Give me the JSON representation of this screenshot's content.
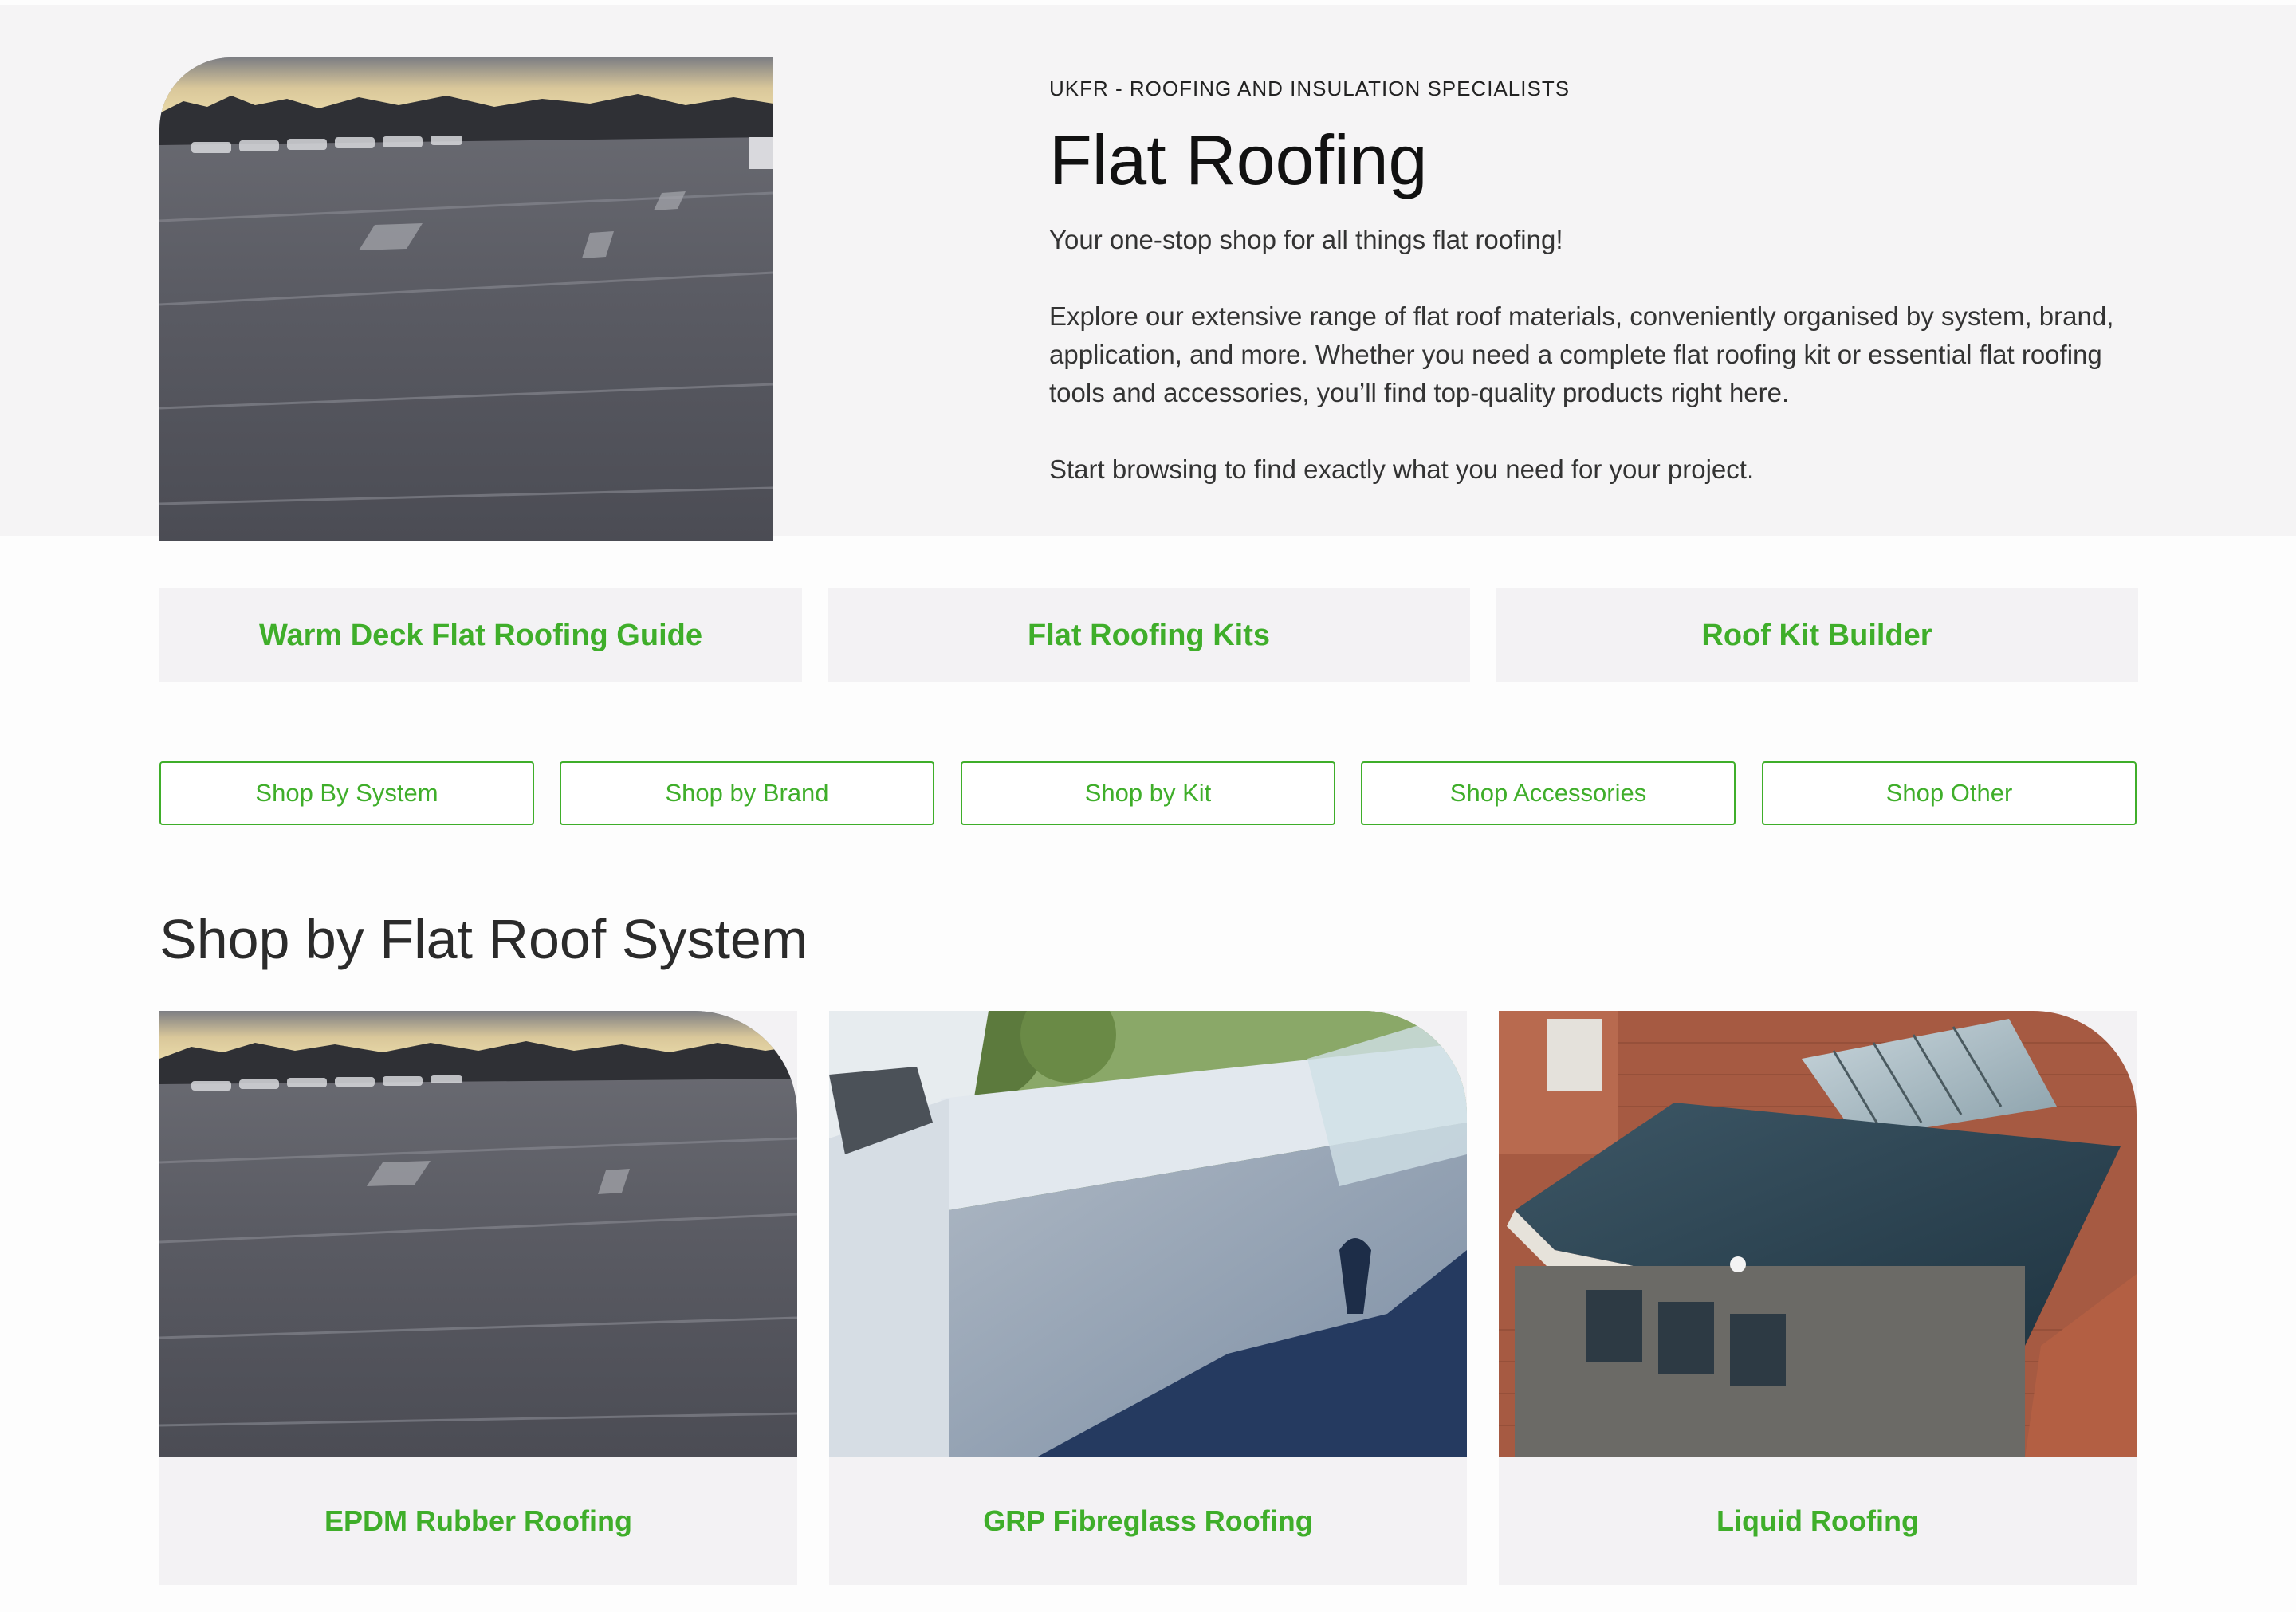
{
  "hero": {
    "eyebrow": "UKFR - ROOFING AND INSULATION SPECIALISTS",
    "title": "Flat Roofing",
    "paragraphs": [
      "Your one-stop shop for all things flat roofing!",
      "Explore our extensive range of flat roof materials, conveniently organised by system, brand, application, and more. Whether you need a complete flat roofing kit or essential flat roofing tools and accessories, you’ll find top-quality products right here.",
      "Start browsing to find exactly what you need for your project."
    ],
    "image": "epdm-roof-photo"
  },
  "link_cards": [
    {
      "label": "Warm Deck Flat Roofing Guide"
    },
    {
      "label": "Flat Roofing Kits"
    },
    {
      "label": "Roof Kit Builder"
    }
  ],
  "shop_buttons": [
    {
      "label": "Shop By System"
    },
    {
      "label": "Shop by Brand"
    },
    {
      "label": "Shop by Kit"
    },
    {
      "label": "Shop Accessories"
    },
    {
      "label": "Shop Other"
    }
  ],
  "systems_section": {
    "title": "Shop by Flat Roof System",
    "cards": [
      {
        "label": "EPDM Rubber Roofing",
        "image": "epdm-roof-photo"
      },
      {
        "label": "GRP Fibreglass Roofing",
        "image": "grp-roof-photo"
      },
      {
        "label": "Liquid Roofing",
        "image": "liquid-roof-photo"
      }
    ]
  },
  "colors": {
    "accent_green": "#3fae2a",
    "panel_grey": "#f3f2f4",
    "hero_bg": "#f5f4f5"
  }
}
